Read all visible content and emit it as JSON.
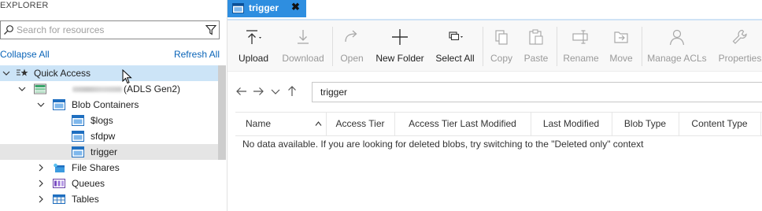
{
  "explorer": {
    "header": "EXPLORER",
    "search_placeholder": "Search for resources",
    "collapse_all": "Collapse All",
    "refresh_all": "Refresh All",
    "tree": {
      "quick_access": "Quick Access",
      "account_suffix": "(ADLS Gen2)",
      "blob_containers": "Blob Containers",
      "containers": [
        "$logs",
        "sfdpw",
        "trigger"
      ],
      "file_shares": "File Shares",
      "queues": "Queues",
      "tables": "Tables"
    }
  },
  "tab": {
    "label": "trigger",
    "close": "✖"
  },
  "toolbar": {
    "upload": "Upload",
    "download": "Download",
    "open": "Open",
    "new_folder": "New Folder",
    "select_all": "Select All",
    "copy": "Copy",
    "paste": "Paste",
    "rename": "Rename",
    "move": "Move",
    "manage_acls": "Manage ACLs",
    "properties": "Properties"
  },
  "path": {
    "value": "trigger"
  },
  "grid": {
    "columns": [
      "Name",
      "Access Tier",
      "Access Tier Last Modified",
      "Last Modified",
      "Blob Type",
      "Content Type"
    ],
    "empty_message": "No data available. If you are looking for deleted blobs, try switching to the \"Deleted only\" context"
  },
  "colors": {
    "accent": "#2e8ee0",
    "link": "#0a64b8",
    "selection": "#cce4f7"
  }
}
